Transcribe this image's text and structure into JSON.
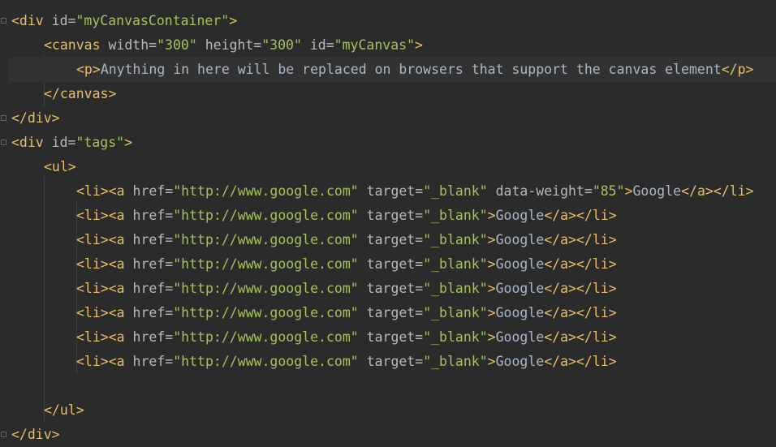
{
  "editor": {
    "lines": [
      {
        "segments": [
          {
            "t": "tag",
            "v": "<div "
          },
          {
            "t": "attr",
            "v": "id="
          },
          {
            "t": "val",
            "v": "\"myCanvasContainer\""
          },
          {
            "t": "tag",
            "v": ">"
          }
        ],
        "indent": 0
      },
      {
        "segments": [
          {
            "t": "tag",
            "v": "<canvas "
          },
          {
            "t": "attr",
            "v": "width="
          },
          {
            "t": "val",
            "v": "\"300\""
          },
          {
            "t": "attr",
            "v": " height="
          },
          {
            "t": "val",
            "v": "\"300\""
          },
          {
            "t": "attr",
            "v": " id="
          },
          {
            "t": "val",
            "v": "\"myCanvas\""
          },
          {
            "t": "tag",
            "v": ">"
          }
        ],
        "indent": 1
      },
      {
        "segments": [
          {
            "t": "tag",
            "v": "<p>"
          },
          {
            "t": "txt",
            "v": "Anything in here will be replaced on browsers that support the canvas element"
          },
          {
            "t": "tag",
            "v": "</p>"
          }
        ],
        "indent": 2
      },
      {
        "segments": [
          {
            "t": "tag",
            "v": "</canvas>"
          }
        ],
        "indent": 1
      },
      {
        "segments": [
          {
            "t": "tag",
            "v": "</div>"
          }
        ],
        "indent": 0
      },
      {
        "segments": [
          {
            "t": "tag",
            "v": "<div "
          },
          {
            "t": "attr",
            "v": "id="
          },
          {
            "t": "val",
            "v": "\"tags\""
          },
          {
            "t": "tag",
            "v": ">"
          }
        ],
        "indent": 0
      },
      {
        "segments": [
          {
            "t": "tag",
            "v": "<ul>"
          }
        ],
        "indent": 1
      },
      {
        "segments": [
          {
            "t": "tag",
            "v": "<li><a "
          },
          {
            "t": "attr",
            "v": "href="
          },
          {
            "t": "val",
            "v": "\"http://www.google.com\""
          },
          {
            "t": "attr",
            "v": " target="
          },
          {
            "t": "val",
            "v": "\"_blank\""
          },
          {
            "t": "attr",
            "v": " data-weight="
          },
          {
            "t": "val",
            "v": "\"85\""
          },
          {
            "t": "tag",
            "v": ">"
          },
          {
            "t": "txt",
            "v": "Google"
          },
          {
            "t": "tag",
            "v": "</a></li>"
          }
        ],
        "indent": 2
      },
      {
        "segments": [
          {
            "t": "tag",
            "v": "<li><a "
          },
          {
            "t": "attr",
            "v": "href="
          },
          {
            "t": "val",
            "v": "\"http://www.google.com\""
          },
          {
            "t": "attr",
            "v": " target="
          },
          {
            "t": "val",
            "v": "\"_blank\""
          },
          {
            "t": "tag",
            "v": ">"
          },
          {
            "t": "txt",
            "v": "Google"
          },
          {
            "t": "tag",
            "v": "</a></li>"
          }
        ],
        "indent": 2
      },
      {
        "segments": [
          {
            "t": "tag",
            "v": "<li><a "
          },
          {
            "t": "attr",
            "v": "href="
          },
          {
            "t": "val",
            "v": "\"http://www.google.com\""
          },
          {
            "t": "attr",
            "v": " target="
          },
          {
            "t": "val",
            "v": "\"_blank\""
          },
          {
            "t": "tag",
            "v": ">"
          },
          {
            "t": "txt",
            "v": "Google"
          },
          {
            "t": "tag",
            "v": "</a></li>"
          }
        ],
        "indent": 2
      },
      {
        "segments": [
          {
            "t": "tag",
            "v": "<li><a "
          },
          {
            "t": "attr",
            "v": "href="
          },
          {
            "t": "val",
            "v": "\"http://www.google.com\""
          },
          {
            "t": "attr",
            "v": " target="
          },
          {
            "t": "val",
            "v": "\"_blank\""
          },
          {
            "t": "tag",
            "v": ">"
          },
          {
            "t": "txt",
            "v": "Google"
          },
          {
            "t": "tag",
            "v": "</a></li>"
          }
        ],
        "indent": 2
      },
      {
        "segments": [
          {
            "t": "tag",
            "v": "<li><a "
          },
          {
            "t": "attr",
            "v": "href="
          },
          {
            "t": "val",
            "v": "\"http://www.google.com\""
          },
          {
            "t": "attr",
            "v": " target="
          },
          {
            "t": "val",
            "v": "\"_blank\""
          },
          {
            "t": "tag",
            "v": ">"
          },
          {
            "t": "txt",
            "v": "Google"
          },
          {
            "t": "tag",
            "v": "</a></li>"
          }
        ],
        "indent": 2
      },
      {
        "segments": [
          {
            "t": "tag",
            "v": "<li><a "
          },
          {
            "t": "attr",
            "v": "href="
          },
          {
            "t": "val",
            "v": "\"http://www.google.com\""
          },
          {
            "t": "attr",
            "v": " target="
          },
          {
            "t": "val",
            "v": "\"_blank\""
          },
          {
            "t": "tag",
            "v": ">"
          },
          {
            "t": "txt",
            "v": "Google"
          },
          {
            "t": "tag",
            "v": "</a></li>"
          }
        ],
        "indent": 2
      },
      {
        "segments": [
          {
            "t": "tag",
            "v": "<li><a "
          },
          {
            "t": "attr",
            "v": "href="
          },
          {
            "t": "val",
            "v": "\"http://www.google.com\""
          },
          {
            "t": "attr",
            "v": " target="
          },
          {
            "t": "val",
            "v": "\"_blank\""
          },
          {
            "t": "tag",
            "v": ">"
          },
          {
            "t": "txt",
            "v": "Google"
          },
          {
            "t": "tag",
            "v": "</a></li>"
          }
        ],
        "indent": 2
      },
      {
        "segments": [
          {
            "t": "tag",
            "v": "<li><a "
          },
          {
            "t": "attr",
            "v": "href="
          },
          {
            "t": "val",
            "v": "\"http://www.google.com\""
          },
          {
            "t": "attr",
            "v": " target="
          },
          {
            "t": "val",
            "v": "\"_blank\""
          },
          {
            "t": "tag",
            "v": ">"
          },
          {
            "t": "txt",
            "v": "Google"
          },
          {
            "t": "tag",
            "v": "</a></li>"
          }
        ],
        "indent": 2
      },
      {
        "segments": [],
        "indent": 0
      },
      {
        "segments": [
          {
            "t": "tag",
            "v": "</ul>"
          }
        ],
        "indent": 1
      },
      {
        "segments": [
          {
            "t": "tag",
            "v": "</div>"
          }
        ],
        "indent": 0
      }
    ],
    "current_line": 2
  },
  "colors": {
    "background": "#2b2b2b",
    "tag": "#e8bf6a",
    "attribute": "#bababa",
    "string": "#a5c25c",
    "text": "#a9b7c6",
    "current_line": "#323232"
  }
}
